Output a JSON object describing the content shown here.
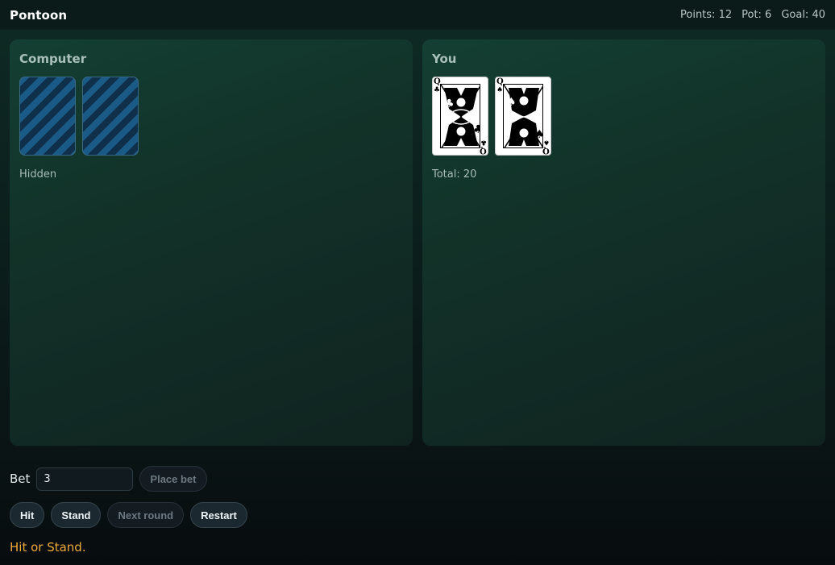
{
  "app": {
    "title": "Pontoon"
  },
  "stats": {
    "points": "Points: 12",
    "pot": "Pot: 6",
    "goal": "Goal: 40"
  },
  "computer": {
    "title": "Computer",
    "cards": [
      "hidden",
      "hidden"
    ],
    "caption": "Hidden"
  },
  "player": {
    "title": "You",
    "cards": [
      {
        "rank": "Q",
        "suit": "♣",
        "name": "queen-of-clubs"
      },
      {
        "rank": "Q",
        "suit": "♠",
        "name": "queen-of-spades"
      }
    ],
    "caption": "Total: 20"
  },
  "controls": {
    "bet_label": "Bet",
    "bet_value": "3",
    "place_bet": "Place bet",
    "hit": "Hit",
    "stand": "Stand",
    "next_round": "Next round",
    "restart": "Restart"
  },
  "status": "Hit or Stand.",
  "colors": {
    "status": "#f0a93a",
    "card_back": "#1a5a86",
    "table": "#143f33"
  }
}
